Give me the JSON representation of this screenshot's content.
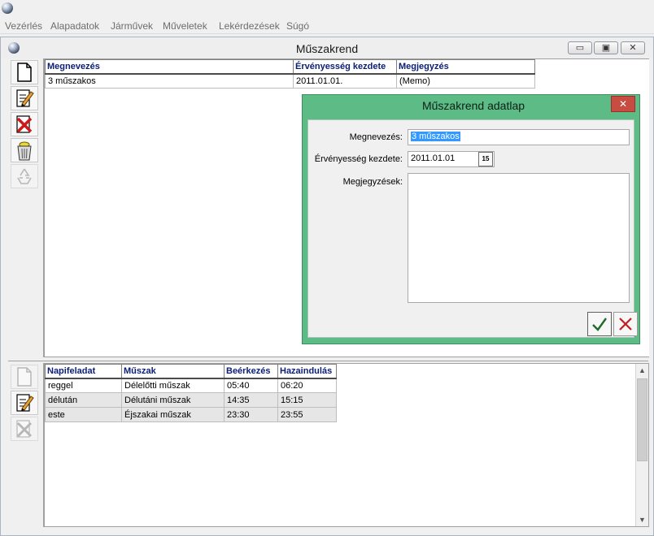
{
  "menu": [
    "Vezérlés",
    "Alapadatok",
    "Járművek",
    "Műveletek",
    "Lekérdezések",
    "Súgó"
  ],
  "mdi": {
    "title": "Műszakrend",
    "caption_buttons": [
      "▭",
      "▣",
      "✕"
    ]
  },
  "top_grid": {
    "columns": [
      "Megnevezés",
      "Érvényesség kezdete",
      "Megjegyzés"
    ],
    "rows": [
      [
        "3 műszakos",
        "2011.01.01.",
        "(Memo)"
      ]
    ]
  },
  "dialog": {
    "title": "Műszakrend adatlap",
    "close": "✕",
    "name_label": "Megnevezés:",
    "name_value": "3 műszakos",
    "valid_label": "Érvényesség kezdete:",
    "valid_value": "2011.01.01",
    "calendar_day": "15",
    "notes_label": "Megjegyzések:",
    "notes_value": ""
  },
  "bottom_grid": {
    "columns": [
      "Napifeladat",
      "Műszak",
      "Beérkezés",
      "Hazaindulás"
    ],
    "rows": [
      [
        "reggel",
        "Délelőtti műszak",
        "05:40",
        "06:20"
      ],
      [
        "délután",
        "Délutáni műszak",
        "14:35",
        "15:15"
      ],
      [
        "este",
        "Éjszakai műszak",
        "23:30",
        "23:55"
      ]
    ]
  },
  "colors": {
    "dialog_frame": "#5dbb85",
    "header_text": "#0b1e77",
    "selection": "#3399ff",
    "close_button": "#c74c42"
  }
}
